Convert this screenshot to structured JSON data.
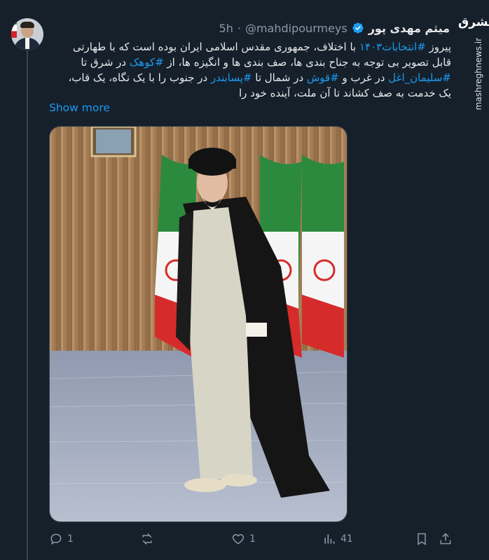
{
  "tweet": {
    "author_name": "میثم مهدی پور",
    "handle": "@mahdipourmeys",
    "separator": "·",
    "time": "5h",
    "text_lines": [
      {
        "parts": [
          {
            "t": "پیروز ",
            "tag": false
          },
          {
            "t": "#انتخابات۱۴۰۳",
            "tag": true
          },
          {
            "t": " با اختلاف، جمهوری مقدس اسلامی ایران بوده است که با طهارتی",
            "tag": false
          }
        ]
      },
      {
        "parts": [
          {
            "t": "قابل تصویر  بی توجه به جناح بندی ها، صف بندی ها و انگیزه ها، از ",
            "tag": false
          },
          {
            "t": "#کوهک",
            "tag": true
          },
          {
            "t": " در شرق تا",
            "tag": false
          }
        ]
      },
      {
        "parts": [
          {
            "t": "#سلیمان_اغل",
            "tag": true
          },
          {
            "t": " در غرب و ",
            "tag": false
          },
          {
            "t": "#قوش",
            "tag": true
          },
          {
            "t": " در شمال تا ",
            "tag": false
          },
          {
            "t": "#پسابندر",
            "tag": true
          },
          {
            "t": " در جنوب را با یک نگاه، یک قاب،",
            "tag": false
          }
        ]
      },
      {
        "parts": [
          {
            "t": "یک خدمت به صف کشاند تا آن ملت، آینده خود را",
            "tag": false
          }
        ]
      }
    ],
    "show_more": "Show more",
    "stats": {
      "replies": "1",
      "reposts": "",
      "likes": "1",
      "views": "41"
    }
  },
  "watermark": {
    "logo": "مشرق",
    "site": "mashreghnews.ir"
  },
  "colors": {
    "background": "#15202b",
    "accent": "#1d9bf0",
    "secondary_text": "#8b98a5"
  },
  "icons": [
    "verified-badge-icon",
    "reply-icon",
    "repost-icon",
    "like-icon",
    "views-icon",
    "bookmark-icon",
    "share-icon"
  ]
}
